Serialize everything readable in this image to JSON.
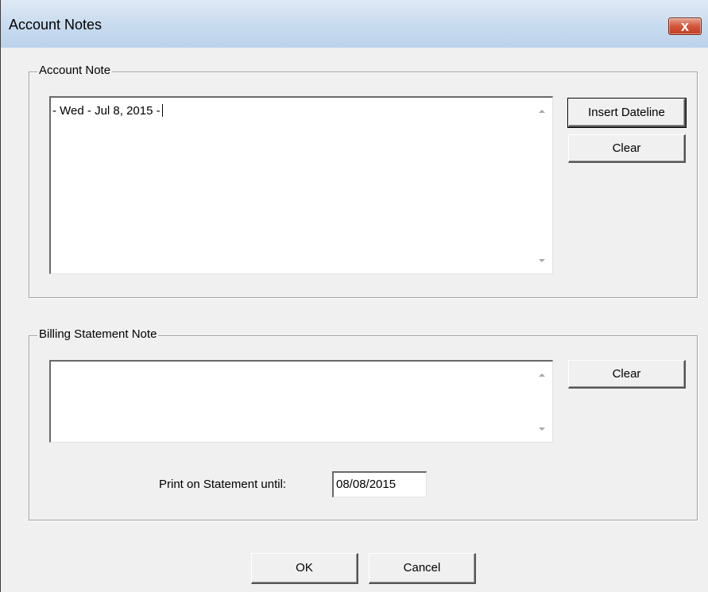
{
  "window": {
    "title": "Account Notes",
    "close_glyph": "x"
  },
  "account_note": {
    "legend": "Account Note",
    "text": "- Wed - Jul 8, 2015 -",
    "insert_dateline_label": "Insert Dateline",
    "clear_label": "Clear"
  },
  "billing_note": {
    "legend": "Billing Statement Note",
    "text": "",
    "clear_label": "Clear",
    "print_until_label": "Print on Statement until:",
    "print_until_value": "08/08/2015"
  },
  "footer": {
    "ok_label": "OK",
    "cancel_label": "Cancel"
  },
  "icons": {
    "scroll_up": "scroll-up-arrow-icon",
    "scroll_down": "scroll-down-arrow-icon",
    "close": "close-icon"
  },
  "colors": {
    "titlebar_top": "#dfe9f5",
    "titlebar_bottom": "#bcd2eb",
    "close_button": "#c23d22",
    "dialog_bg": "#f0f0f0"
  }
}
